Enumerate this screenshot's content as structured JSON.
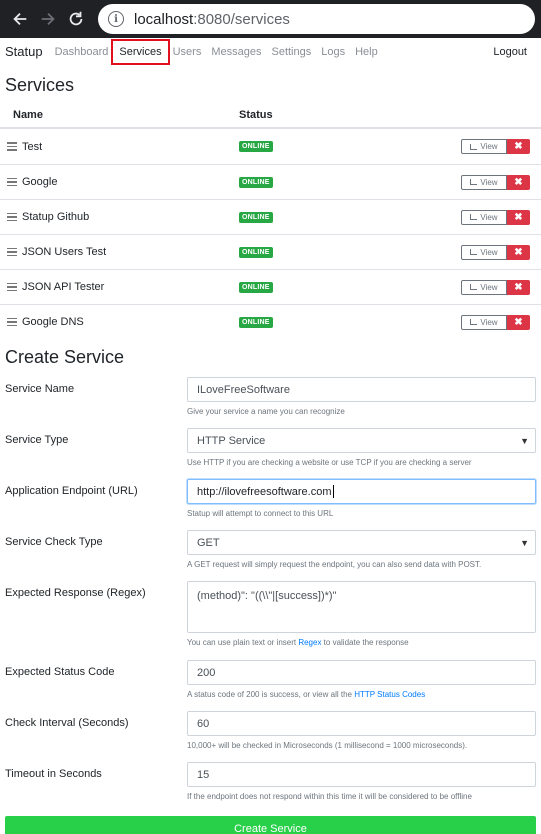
{
  "browser": {
    "host": "localhost",
    "path": ":8080/services"
  },
  "nav": {
    "brand": "Statup",
    "links": [
      "Dashboard",
      "Services",
      "Users",
      "Messages",
      "Settings",
      "Logs",
      "Help"
    ],
    "logout": "Logout"
  },
  "services": {
    "title": "Services",
    "col_name": "Name",
    "col_status": "Status",
    "view_label": "View",
    "delete_label": "✖",
    "rows": [
      {
        "name": "Test",
        "status": "ONLINE"
      },
      {
        "name": "Google",
        "status": "ONLINE"
      },
      {
        "name": "Statup Github",
        "status": "ONLINE"
      },
      {
        "name": "JSON Users Test",
        "status": "ONLINE"
      },
      {
        "name": "JSON API Tester",
        "status": "ONLINE"
      },
      {
        "name": "Google DNS",
        "status": "ONLINE"
      }
    ]
  },
  "create": {
    "title": "Create Service",
    "service_name": {
      "label": "Service Name",
      "value": "ILoveFreeSoftware",
      "help": "Give your service a name you can recognize"
    },
    "service_type": {
      "label": "Service Type",
      "value": "HTTP Service",
      "help": "Use HTTP if you are checking a website or use TCP if you are checking a server"
    },
    "endpoint": {
      "label": "Application Endpoint (URL)",
      "value": "http://ilovefreesoftware.com",
      "help": "Statup will attempt to connect to this URL"
    },
    "check_type": {
      "label": "Service Check Type",
      "value": "GET",
      "help": "A GET request will simply request the endpoint, you can also send data with POST."
    },
    "expected_response": {
      "label": "Expected Response (Regex)",
      "placeholder": "(method)\": \"((\\\\\"|[success])*)\"",
      "help_prefix": "You can use plain text or insert ",
      "help_link": "Regex",
      "help_suffix": " to validate the response"
    },
    "status_code": {
      "label": "Expected Status Code",
      "value": "200",
      "help_prefix": "A status code of 200 is success, or view all the ",
      "help_link": "HTTP Status Codes"
    },
    "interval": {
      "label": "Check Interval (Seconds)",
      "value": "60",
      "help": "10,000+ will be checked in Microseconds (1 millisecond = 1000 microseconds)."
    },
    "timeout": {
      "label": "Timeout in Seconds",
      "value": "15",
      "help": "If the endpoint does not respond within this time it will be considered to be offline"
    },
    "submit": "Create Service"
  },
  "colors": {
    "online": "#28a745",
    "delete": "#dc3545",
    "submit": "#28d04a",
    "highlight": "#e0101e"
  }
}
